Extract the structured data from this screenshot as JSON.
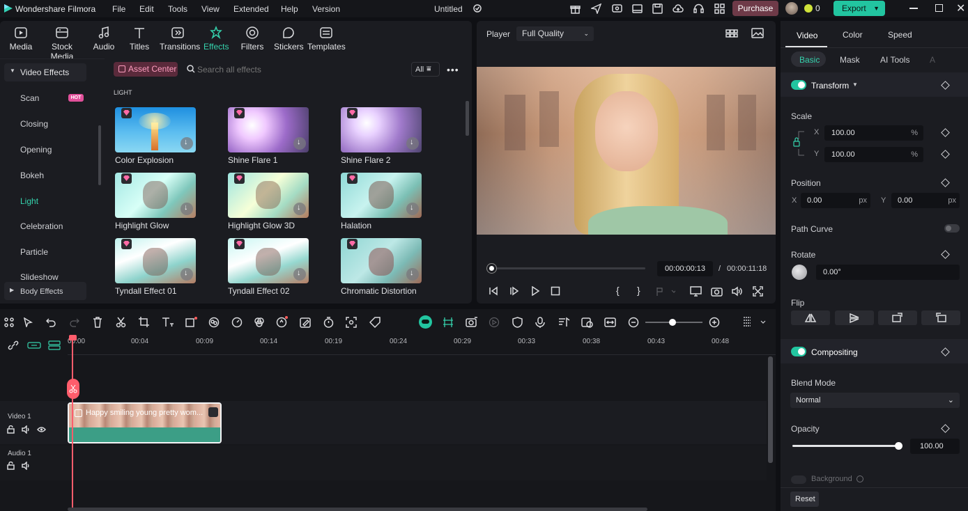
{
  "app": {
    "name": "Wondershare Filmora",
    "doc_title": "Untitled"
  },
  "menu": [
    "File",
    "Edit",
    "Tools",
    "View",
    "Extended",
    "Help",
    "Version"
  ],
  "titlebar": {
    "purchase_label": "Purchase",
    "export_label": "Export",
    "credits": "0"
  },
  "toolbar": [
    "Media",
    "Stock Media",
    "Audio",
    "Titles",
    "Transitions",
    "Effects",
    "Filters",
    "Stickers",
    "Templates"
  ],
  "library": {
    "group_label": "Video Effects",
    "categories": [
      "Scan",
      "Closing",
      "Opening",
      "Bokeh",
      "Light",
      "Celebration",
      "Particle",
      "Slideshow"
    ],
    "hot_badge": "HOT",
    "body_effects": "Body Effects",
    "asset_center": "Asset Center",
    "search_placeholder": "Search all effects",
    "filter_label": "All",
    "section_title": "LIGHT",
    "effects": [
      "Color Explosion",
      "Shine Flare 1",
      "Shine Flare 2",
      "Highlight Glow",
      "Highlight Glow 3D",
      "Halation",
      "Tyndall Effect 01",
      "Tyndall Effect 02",
      "Chromatic Distortion"
    ]
  },
  "player": {
    "label": "Player",
    "quality": "Full Quality",
    "current_time": "00:00:00:13",
    "total_time": "00:00:11:18",
    "progress": 0.02
  },
  "inspector": {
    "tabs": [
      "Video",
      "Color",
      "Speed"
    ],
    "subtabs": [
      "Basic",
      "Mask",
      "AI Tools",
      "A"
    ],
    "transform_label": "Transform",
    "scale_label": "Scale",
    "scale_x": "100.00",
    "scale_y": "100.00",
    "percent": "%",
    "position_label": "Position",
    "pos_x": "0.00",
    "pos_y": "0.00",
    "px": "px",
    "x": "X",
    "y": "Y",
    "path_curve_label": "Path Curve",
    "rotate_label": "Rotate",
    "rotate_value": "0.00°",
    "flip_label": "Flip",
    "compositing_label": "Compositing",
    "blend_mode_label": "Blend Mode",
    "blend_mode": "Normal",
    "opacity_label": "Opacity",
    "opacity_value": "100.00",
    "opacity_level": 1.0,
    "background_label": "Background",
    "reset_label": "Reset"
  },
  "timeline": {
    "ruler": [
      "00:00",
      "00:04",
      "00:09",
      "00:14",
      "00:19",
      "00:24",
      "00:29",
      "00:33",
      "00:38",
      "00:43",
      "00:48"
    ],
    "video_track": "Video 1",
    "audio_track": "Audio 1",
    "clip_title": "Happy smiling young pretty wom..."
  }
}
